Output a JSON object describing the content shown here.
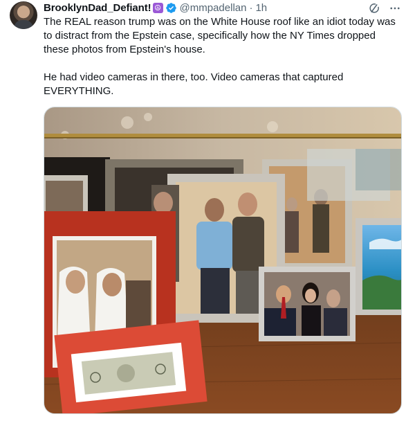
{
  "post": {
    "display_name": "BrooklynDad_Defiant!",
    "emoji": "☮",
    "handle": "@mmpadellan",
    "separator": "·",
    "time": "1h",
    "paragraphs": [
      "The REAL reason trump was on the White House roof like an idiot today was to distract from the Epstein case, specifically how the NY Times dropped these photos from Epstein's house.",
      "He had video cameras in there, too. Video cameras that captured EVERYTHING."
    ]
  },
  "icons": {
    "avatar": "avatar",
    "verified": "verified-badge-icon",
    "grok": "grok-icon",
    "more": "more-icon"
  },
  "colors": {
    "text": "#0f1419",
    "secondary": "#536471",
    "verified": "#1d9bf0",
    "emoji_bg": "#9b59d6"
  }
}
